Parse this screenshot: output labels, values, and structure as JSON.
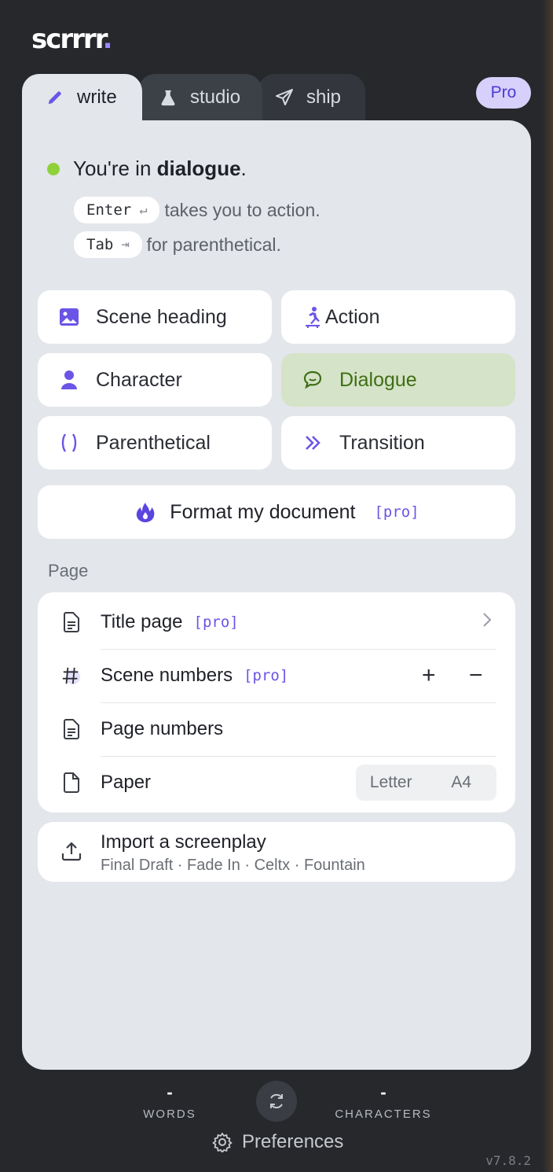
{
  "app": {
    "logo_text": "scrrrr",
    "logo_dot": "."
  },
  "tabs": [
    {
      "label": "write",
      "icon": "pencil-icon",
      "active": true
    },
    {
      "label": "studio",
      "icon": "flask-icon",
      "active": false
    },
    {
      "label": "ship",
      "icon": "send-icon",
      "active": false
    }
  ],
  "pro_badge": "Pro",
  "status": {
    "prefix": "You're in ",
    "mode": "dialogue",
    "suffix": ".",
    "dot_color": "#8fd13a"
  },
  "hints": [
    {
      "key": "Enter",
      "key_symbol": "↵",
      "text": "takes you to action."
    },
    {
      "key": "Tab",
      "key_symbol": "⇥",
      "text": "for parenthetical."
    }
  ],
  "elements": [
    {
      "label": "Scene heading",
      "icon": "image-icon",
      "active": false
    },
    {
      "label": "Action",
      "icon": "skater-icon",
      "active": false
    },
    {
      "label": "Character",
      "icon": "person-icon",
      "active": false
    },
    {
      "label": "Dialogue",
      "icon": "speech-bubble-icon",
      "active": true
    },
    {
      "label": "Parenthetical",
      "icon": "parentheses-icon",
      "active": false
    },
    {
      "label": "Transition",
      "icon": "double-chevron-right-icon",
      "active": false
    }
  ],
  "format_button": {
    "label": "Format my document",
    "tag": "[pro]"
  },
  "page_section": {
    "label": "Page",
    "title_page": {
      "label": "Title page",
      "tag": "[pro]"
    },
    "scene_numbers": {
      "label": "Scene numbers",
      "tag": "[pro]",
      "plus": "+",
      "minus": "−"
    },
    "page_numbers": {
      "label": "Page numbers"
    },
    "paper": {
      "label": "Paper",
      "options": [
        "Letter",
        "A4"
      ]
    }
  },
  "import": {
    "title": "Import a screenplay",
    "formats": "Final Draft · Fade In · Celtx · Fountain"
  },
  "footer": {
    "words_value": "-",
    "words_label": "WORDS",
    "characters_value": "-",
    "characters_label": "CHARACTERS",
    "preferences": "Preferences",
    "version": "v7.8.2"
  },
  "colors": {
    "accent": "#6a55e6",
    "dialogue_bg": "#d5e3c8",
    "dialogue_text": "#3f6e14",
    "pro_bg": "#d7d0fb"
  }
}
